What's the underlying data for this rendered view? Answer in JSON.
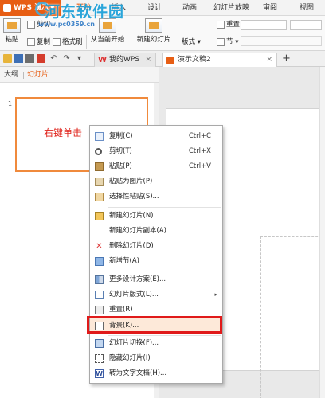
{
  "menubar": {
    "app_label": "WPS 演示",
    "tabs": [
      "开始",
      "插入",
      "设计",
      "动画",
      "幻灯片放映",
      "审阅",
      "视图"
    ],
    "active_tab": "开始"
  },
  "watermark": {
    "title": "河东软件园",
    "url": "www.pc0359.cn"
  },
  "ribbon": {
    "paste": "粘贴",
    "cut": "剪切",
    "copy": "复制",
    "format_painter": "格式刷",
    "from_current": "从当前开始",
    "new_slide": "新建幻灯片",
    "layout": "版式",
    "reset": "重置",
    "section": "节"
  },
  "doc_tabs": [
    {
      "label": "我的WPS",
      "close": "×"
    },
    {
      "label": "演示文稿2",
      "close": "×"
    }
  ],
  "left_panel": {
    "tabs": [
      "大纲",
      "幻灯片"
    ],
    "active_tab": "幻灯片",
    "slide_number": "1",
    "thumb_text": "右键单击"
  },
  "context_menu": {
    "items": [
      {
        "label": "复制(C)",
        "shortcut": "Ctrl+C",
        "icon": "copy-icon"
      },
      {
        "label": "剪切(T)",
        "shortcut": "Ctrl+X",
        "icon": "scissors-icon"
      },
      {
        "label": "粘贴(P)",
        "shortcut": "Ctrl+V",
        "icon": "paste-icon"
      },
      {
        "label": "粘贴为图片(P)",
        "shortcut": "",
        "icon": "paste-image-icon"
      },
      {
        "label": "选择性粘贴(S)...",
        "shortcut": "",
        "icon": "paste-special-icon"
      },
      {
        "label": "新建幻灯片(N)",
        "shortcut": "",
        "icon": "new-slide-icon"
      },
      {
        "label": "新建幻灯片副本(A)",
        "shortcut": "",
        "icon": "duplicate-slide-icon"
      },
      {
        "label": "删除幻灯片(D)",
        "shortcut": "",
        "icon": "delete-icon"
      },
      {
        "label": "新增节(A)",
        "shortcut": "",
        "icon": "section-icon"
      },
      {
        "label": "更多设计方案(E)...",
        "shortcut": "",
        "icon": "design-icon"
      },
      {
        "label": "幻灯片版式(L)...",
        "shortcut": "",
        "icon": "layout-icon",
        "submenu": "▸"
      },
      {
        "label": "重置(R)",
        "shortcut": "",
        "icon": "reset-icon"
      },
      {
        "label": "背景(K)...",
        "shortcut": "",
        "icon": "background-icon",
        "highlighted": true
      },
      {
        "label": "幻灯片切换(F)...",
        "shortcut": "",
        "icon": "transition-icon"
      },
      {
        "label": "隐藏幻灯片(I)",
        "shortcut": "",
        "icon": "hide-slide-icon"
      },
      {
        "label": "转为文字文档(H)...",
        "shortcut": "",
        "icon": "convert-to-text-icon"
      }
    ]
  },
  "colors": {
    "accent": "#e75e14",
    "highlight_box": "#e01a1a",
    "thumb_border": "#f08a3c",
    "thumb_text": "#e0241c"
  }
}
